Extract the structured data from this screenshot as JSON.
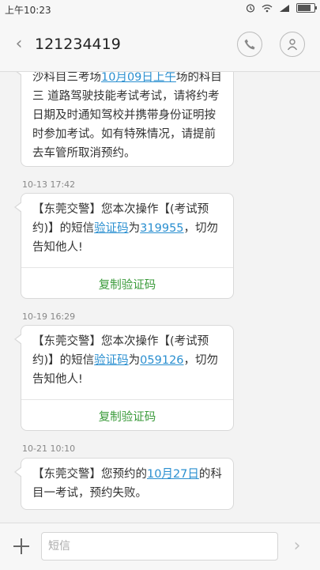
{
  "status_bar": {
    "time": "上午10:23",
    "icons": [
      "alarm-icon",
      "wifi-icon",
      "signal-icon",
      "battery-icon"
    ]
  },
  "header": {
    "contact": "121234419",
    "back_icon": "chevron-left-icon",
    "call_icon": "phone-icon",
    "contact_icon": "person-icon"
  },
  "messages": [
    {
      "parts": {
        "p0": "沙科目三考场",
        "link0": "10月09日上午",
        "p1": "场的科目三 道路驾驶技能考试考试，请将约考日期及时通知驾校并携带身份证明按时参加考试。如有特殊情况，请提前去车管所取消预约。"
      }
    },
    {
      "timestamp": "10-13 17:42",
      "parts": {
        "p0": "【东莞交警】您本次操作【(考试预约)】的短信",
        "link0": "验证码",
        "p1": "为",
        "link1": "319955",
        "p2": "，切勿告知他人!"
      },
      "action": "复制验证码"
    },
    {
      "timestamp": "10-19 16:29",
      "parts": {
        "p0": "【东莞交警】您本次操作【(考试预约)】的短信",
        "link0": "验证码",
        "p1": "为",
        "link1": "059126",
        "p2": "，切勿告知他人!"
      },
      "action": "复制验证码"
    },
    {
      "timestamp": "10-21 10:10",
      "parts": {
        "p0": "【东莞交警】您预约的",
        "link0": "10月27日",
        "p1": "的科目一考试，预约失败。"
      }
    }
  ],
  "composer": {
    "placeholder": "短信",
    "add_icon": "plus-icon",
    "send_icon": "chevron-right-icon"
  },
  "colors": {
    "link": "#2a8fd0",
    "action": "#3b9b3b",
    "background": "#f3f3f3"
  }
}
